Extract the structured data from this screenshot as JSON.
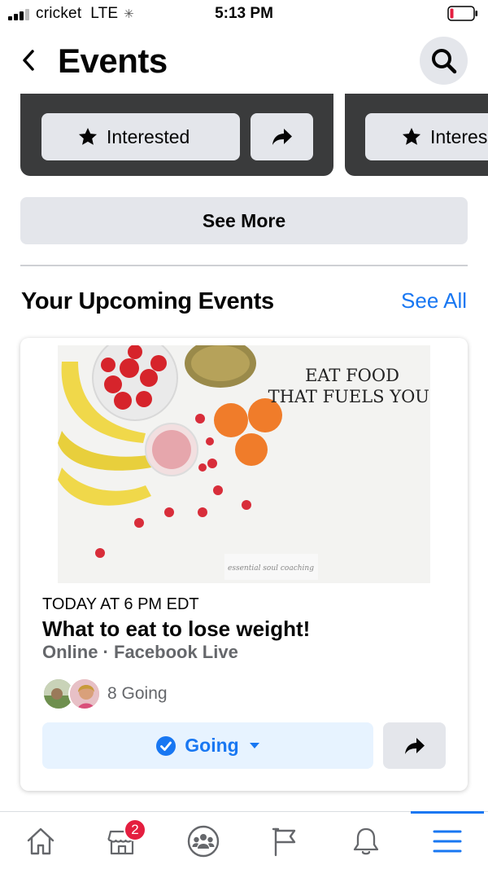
{
  "status_bar": {
    "carrier": "cricket",
    "network": "LTE",
    "time": "5:13 PM"
  },
  "header": {
    "title": "Events",
    "back_icon": "chevron-left-icon",
    "search_icon": "search-icon"
  },
  "carousel": {
    "cards": [
      {
        "interested_label": "Interested",
        "share_icon": "share-arrow-icon"
      },
      {
        "interested_label": "Interes"
      }
    ],
    "see_more_label": "See More"
  },
  "upcoming": {
    "section_title": "Your Upcoming Events",
    "see_all_label": "See All",
    "event": {
      "image_caption_line1": "EAT FOOD",
      "image_caption_line2": "THAT FUELS YOU!",
      "image_watermark": "essential soul coaching",
      "date": "TODAY AT 6 PM EDT",
      "title": "What to eat to lose weight!",
      "location": "Online · Facebook Live",
      "going_count": "8 Going",
      "going_button_label": "Going",
      "status_color": "#1877f2"
    }
  },
  "tab_bar": {
    "tabs": [
      {
        "name": "home",
        "icon": "home-icon"
      },
      {
        "name": "marketplace",
        "icon": "marketplace-icon",
        "badge": "2"
      },
      {
        "name": "groups",
        "icon": "groups-icon"
      },
      {
        "name": "pages",
        "icon": "flag-icon"
      },
      {
        "name": "notifications",
        "icon": "bell-icon"
      },
      {
        "name": "menu",
        "icon": "menu-icon",
        "active": true
      }
    ]
  }
}
